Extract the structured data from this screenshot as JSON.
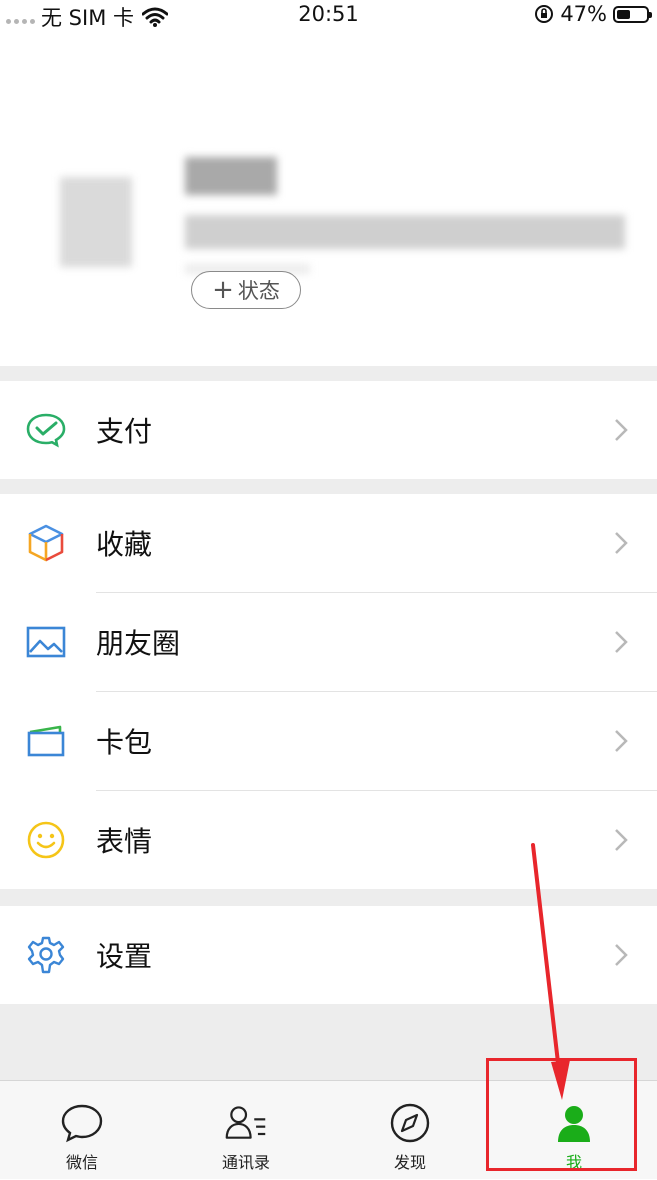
{
  "status_bar": {
    "carrier": "无 SIM 卡",
    "time": "20:51",
    "battery_percent": "47%",
    "battery_level": 0.47
  },
  "profile": {
    "status_button_label": "状态"
  },
  "menu": {
    "pay": {
      "label": "支付",
      "icon": "wechat-pay-icon"
    },
    "favorites": {
      "label": "收藏",
      "icon": "cube-icon"
    },
    "moments": {
      "label": "朋友圈",
      "icon": "image-icon"
    },
    "cards": {
      "label": "卡包",
      "icon": "card-icon"
    },
    "stickers": {
      "label": "表情",
      "icon": "smiley-icon"
    },
    "settings": {
      "label": "设置",
      "icon": "gear-icon"
    }
  },
  "tab_bar": {
    "tabs": [
      {
        "label": "微信",
        "icon": "chat-bubble-icon"
      },
      {
        "label": "通讯录",
        "icon": "contacts-icon"
      },
      {
        "label": "发现",
        "icon": "compass-icon"
      },
      {
        "label": "我",
        "icon": "person-icon",
        "active": true
      }
    ]
  },
  "colors": {
    "accent_green": "#1aad19",
    "annotation_red": "#e8262c",
    "separator_gray": "#ededed"
  }
}
